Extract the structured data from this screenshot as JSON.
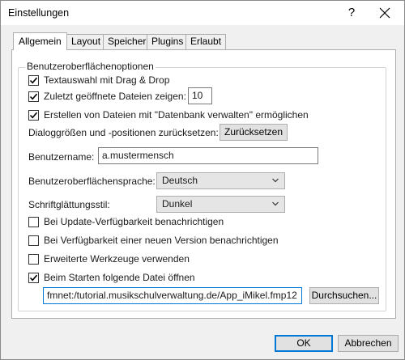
{
  "window": {
    "title": "Einstellungen",
    "help_glyph": "?"
  },
  "tabs": [
    {
      "label": "Allgemein",
      "active": true
    },
    {
      "label": "Layout",
      "active": false
    },
    {
      "label": "Speicher",
      "active": false
    },
    {
      "label": "Plugins",
      "active": false
    },
    {
      "label": "Erlaubt",
      "active": false
    }
  ],
  "group": {
    "legend": "Benutzeroberflächenoptionen"
  },
  "options": {
    "drag_drop": {
      "label": "Textauswahl mit Drag & Drop",
      "checked": true
    },
    "recent_files": {
      "label": "Zuletzt geöffnete Dateien zeigen:",
      "checked": true,
      "value": "10"
    },
    "create_files": {
      "label": "Erstellen von Dateien mit \"Datenbank verwalten\" ermöglichen",
      "checked": true
    },
    "reset": {
      "label": "Dialoggrößen und -positionen zurücksetzen:",
      "button": "Zurücksetzen"
    },
    "username": {
      "label": "Benutzername:",
      "value": "a.mustermensch"
    },
    "ui_language": {
      "label": "Benutzeroberflächensprache:",
      "selected": "Deutsch"
    },
    "smoothing": {
      "label": "Schriftglättungsstil:",
      "selected": "Dunkel"
    },
    "update_notify": {
      "label": "Bei Update-Verfügbarkeit benachrichtigen",
      "checked": false
    },
    "version_notify": {
      "label": "Bei Verfügbarkeit einer neuen Version benachrichtigen",
      "checked": false
    },
    "advanced_tools": {
      "label": "Erweiterte Werkzeuge verwenden",
      "checked": false
    },
    "open_on_start": {
      "label": "Beim Starten folgende Datei öffnen",
      "checked": true
    },
    "startup_file": {
      "value": "fmnet:/tutorial.musikschulverwaltung.de/App_iMikel.fmp12",
      "browse": "Durchsuchen..."
    }
  },
  "footer": {
    "ok": "OK",
    "cancel": "Abbrechen"
  },
  "colors": {
    "accent": "#0078d7"
  }
}
